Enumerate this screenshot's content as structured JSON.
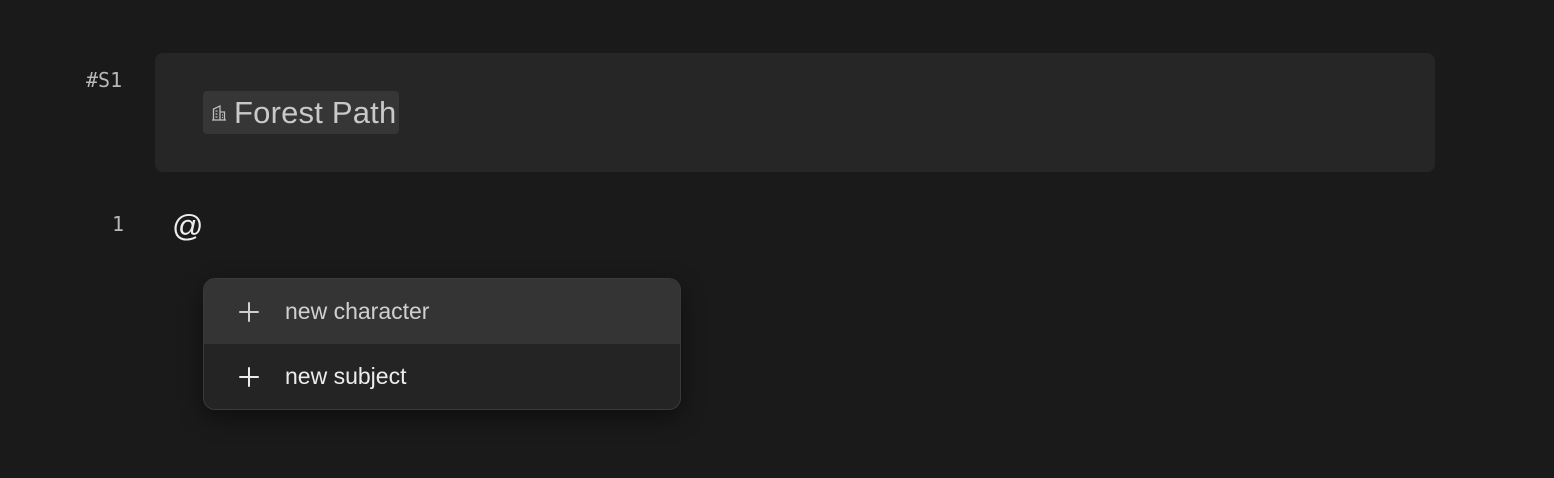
{
  "scene": {
    "number": "#S1",
    "location": {
      "icon": "building-icon",
      "label": "Forest Path"
    }
  },
  "editor": {
    "line_number": "1",
    "text": "@"
  },
  "mention_menu": {
    "items": [
      {
        "icon": "plus-icon",
        "label": "new character",
        "highlighted": true
      },
      {
        "icon": "plus-icon",
        "label": "new subject",
        "highlighted": false
      }
    ]
  },
  "colors": {
    "background": "#1a1a1a",
    "card": "#262626",
    "chip": "#363636",
    "menu": "#242424",
    "menu_highlight": "#343434"
  }
}
